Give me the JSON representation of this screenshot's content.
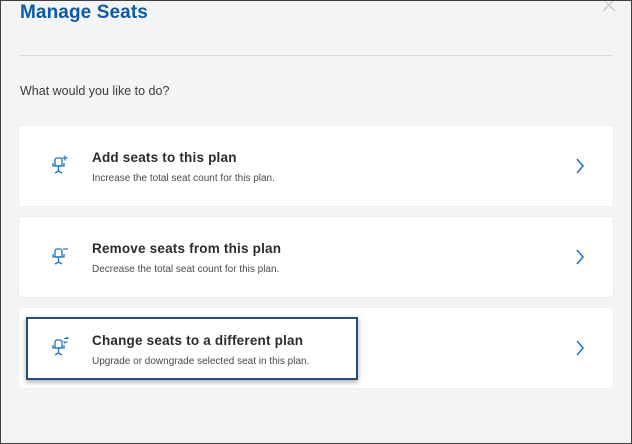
{
  "dialog": {
    "title": "Manage Seats",
    "prompt": "What would you like to do?"
  },
  "options": [
    {
      "title": "Add seats to this plan",
      "description": "Increase the total seat count for this plan.",
      "icon": "seat-add-icon"
    },
    {
      "title": "Remove seats from this plan",
      "description": "Decrease the total seat count for this plan.",
      "icon": "seat-remove-icon"
    },
    {
      "title": "Change seats to a different plan",
      "description": "Upgrade or downgrade selected seat in this plan.",
      "icon": "seat-change-icon"
    }
  ],
  "colors": {
    "title": "#0d5aa7",
    "icon_accent": "#1a73c9",
    "highlight_border": "#23507a"
  }
}
